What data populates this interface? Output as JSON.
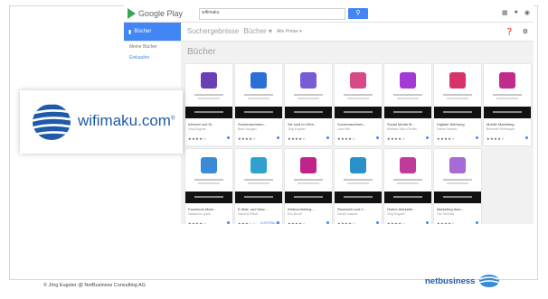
{
  "store": {
    "name": "Google Play"
  },
  "search": {
    "value": "wifimaku",
    "button_icon": "search-icon"
  },
  "top_icons": [
    "apps-grid-icon",
    "bell-icon",
    "avatar"
  ],
  "subbar": {
    "active_tab": "Bücher",
    "crumbs": [
      "Suchergebnisse",
      "Bücher ▾"
    ],
    "filter": "Alle Preise ▾",
    "icons": [
      "help-icon",
      "settings-icon"
    ]
  },
  "sidebar": {
    "items": [
      "Meine Bücher",
      "Einkaufen"
    ]
  },
  "section_title": "Bücher",
  "colors": {
    "accent": "#4285f4",
    "play_green": "#34a853",
    "wifimaku_blue": "#1f5aa8"
  },
  "books": [
    {
      "cover_color": "#6a3fb5",
      "title": "Internet und Di...",
      "author": "Jörg Eugster",
      "rating": "★★★★☆",
      "price": ""
    },
    {
      "cover_color": "#2b6fd6",
      "title": "Suchmaschinen...",
      "author": "Beat Zwygart",
      "rating": "★★★★☆",
      "price": ""
    },
    {
      "cover_color": "#7a5bd6",
      "title": "Sie sind im Web...",
      "author": "Jörg Eugster",
      "rating": "★★★★☆",
      "price": ""
    },
    {
      "cover_color": "#d64a8a",
      "title": "Suchmaschinen...",
      "author": "Lara Hiltl",
      "rating": "★★★★☆",
      "price": ""
    },
    {
      "cover_color": "#a43ad6",
      "title": "Social Media M...",
      "author": "Mathias Sabo Rindlis",
      "rating": "★★★★☆",
      "price": ""
    },
    {
      "cover_color": "#d6336c",
      "title": "Digitale Werbung",
      "author": "Daniel Imsand",
      "rating": "★★★★☆",
      "price": ""
    },
    {
      "cover_color": "#c02c8c",
      "title": "Mobile Marketing",
      "author": "Benedikt Röthlingsh",
      "rating": "★★★★☆",
      "price": ""
    },
    {
      "cover_color": "#3a8ad6",
      "title": "Facebook-Mark...",
      "author": "Natascha Ljubic",
      "rating": "★★★★☆",
      "price": ""
    },
    {
      "cover_color": "#2fa0d0",
      "title": "E-Mail- und New...",
      "author": "Sabrina Reber",
      "rating": "★★★☆☆",
      "price": "KOSTENLOS"
    },
    {
      "cover_color": "#c0238a",
      "title": "Webcontrolling...",
      "author": "Elio Bondi",
      "rating": "★★★★☆",
      "price": ""
    },
    {
      "cover_color": "#2a90c8",
      "title": "Research und C...",
      "author": "Daniel Imsand",
      "rating": "★★★★☆",
      "price": ""
    },
    {
      "cover_color": "#c03a9a",
      "title": "Online-Marketin...",
      "author": "Jörg Eugster",
      "rating": "★★★★☆",
      "price": ""
    },
    {
      "cover_color": "#a86ad6",
      "title": "Marketing Auto...",
      "author": "Ole Schmidt",
      "rating": "★★★★☆",
      "price": ""
    }
  ],
  "logo": {
    "brand": "wifimaku.com",
    "reg": "®"
  },
  "footer": {
    "copyright": "© Jörg Eugster @ NetBusiness Consulting AG",
    "company": "netbusiness"
  }
}
